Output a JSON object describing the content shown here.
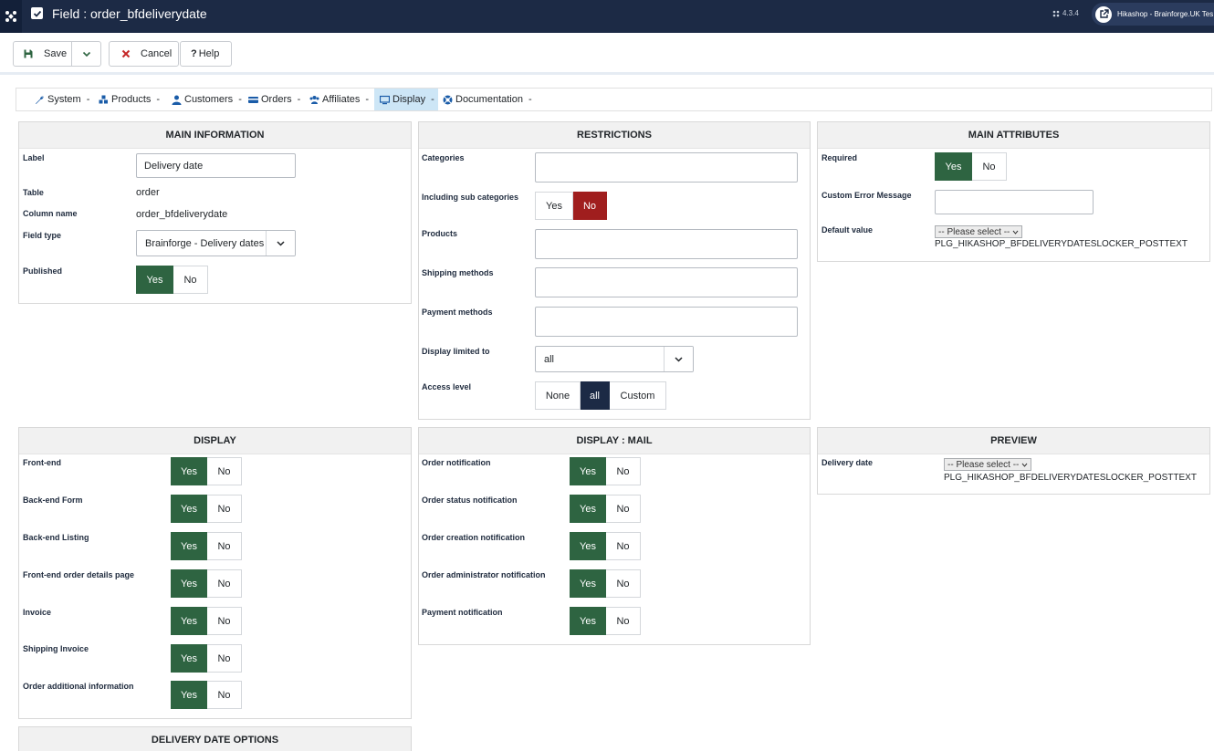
{
  "header": {
    "title": "Field : order_bfdeliverydate",
    "version": "4.3.4",
    "site_name": "Hikashop - Brainforge.UK Tes..."
  },
  "toolbar": {
    "save_label": "Save",
    "cancel_label": "Cancel",
    "help_label": "Help"
  },
  "menu": {
    "items": [
      {
        "label": "System",
        "icon": "wrench-icon"
      },
      {
        "label": "Products",
        "icon": "cubes-icon"
      },
      {
        "label": "Customers",
        "icon": "user-icon"
      },
      {
        "label": "Orders",
        "icon": "credit-card-icon"
      },
      {
        "label": "Affiliates",
        "icon": "users-icon"
      },
      {
        "label": "Display",
        "icon": "monitor-icon"
      },
      {
        "label": "Documentation",
        "icon": "lifebuoy-icon"
      }
    ],
    "dash": "-"
  },
  "main_information": {
    "title": "MAIN INFORMATION",
    "label_label": "Label",
    "label_value": "Delivery date",
    "table_label": "Table",
    "table_value": "order",
    "column_label": "Column name",
    "column_value": "order_bfdeliverydate",
    "fieldtype_label": "Field type",
    "fieldtype_value": "Brainforge - Delivery dates f",
    "published_label": "Published"
  },
  "restrictions": {
    "title": "RESTRICTIONS",
    "categories_label": "Categories",
    "subcat_label": "Including sub categories",
    "products_label": "Products",
    "shipping_label": "Shipping methods",
    "payment_label": "Payment methods",
    "display_limited_label": "Display limited to",
    "display_limited_value": "all",
    "access_label": "Access level",
    "access_none": "None",
    "access_all": "all",
    "access_custom": "Custom"
  },
  "main_attributes": {
    "title": "MAIN ATTRIBUTES",
    "required_label": "Required",
    "error_label": "Custom Error Message",
    "default_label": "Default value",
    "default_select": "-- Please select --",
    "posttext": "PLG_HIKASHOP_BFDELIVERYDATESLOCKER_POSTTEXT"
  },
  "display": {
    "title": "DISPLAY",
    "rows": [
      "Front-end",
      "Back-end Form",
      "Back-end Listing",
      "Front-end order details page",
      "Invoice",
      "Shipping Invoice",
      "Order additional information"
    ]
  },
  "display_mail": {
    "title": "DISPLAY : MAIL",
    "rows": [
      "Order notification",
      "Order status notification",
      "Order creation notification",
      "Order administrator notification",
      "Payment notification"
    ]
  },
  "preview": {
    "title": "PREVIEW",
    "field_label": "Delivery date",
    "select": "-- Please select --",
    "posttext": "PLG_HIKASHOP_BFDELIVERYDATESLOCKER_POSTTEXT"
  },
  "delivery_options": {
    "title": "DELIVERY DATE OPTIONS"
  },
  "common": {
    "yes": "Yes",
    "no": "No"
  },
  "colors": {
    "header_bg": "#1c2a45",
    "yes_active": "#2e6441",
    "no_active": "#a01e1e",
    "menu_active": "#cde6f6"
  }
}
